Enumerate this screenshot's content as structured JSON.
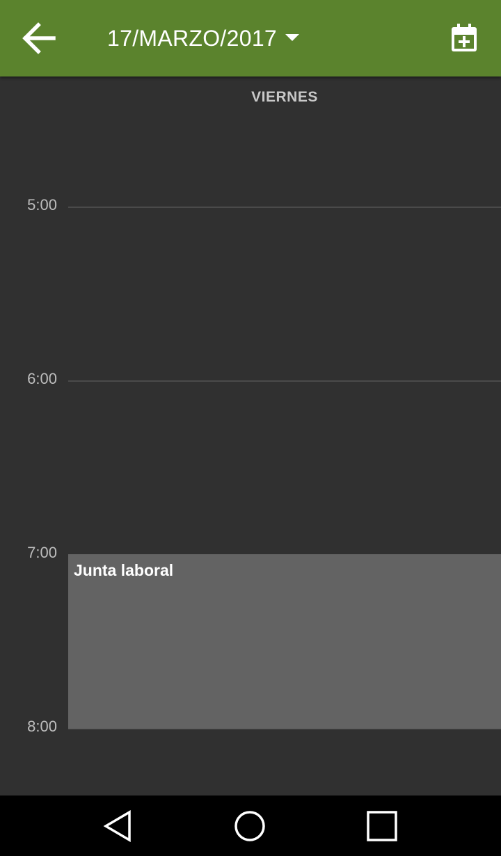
{
  "toolbar": {
    "back_icon": "arrow-back-icon",
    "date_label": "17/MARZO/2017",
    "dropdown_icon": "dropdown-triangle-icon",
    "add_event_icon": "calendar-plus-icon",
    "background_color": "#5b832d"
  },
  "day": {
    "weekday": "VIERNES"
  },
  "schedule": {
    "hours": [
      "5:00",
      "6:00",
      "7:00",
      "8:00"
    ],
    "events": [
      {
        "title": "Junta laboral",
        "start": "7:00",
        "end": "8:00",
        "color": "#636363"
      }
    ]
  },
  "navbar": {
    "back_icon": "nav-back-triangle-icon",
    "home_icon": "nav-home-circle-icon",
    "recents_icon": "nav-recents-square-icon"
  }
}
